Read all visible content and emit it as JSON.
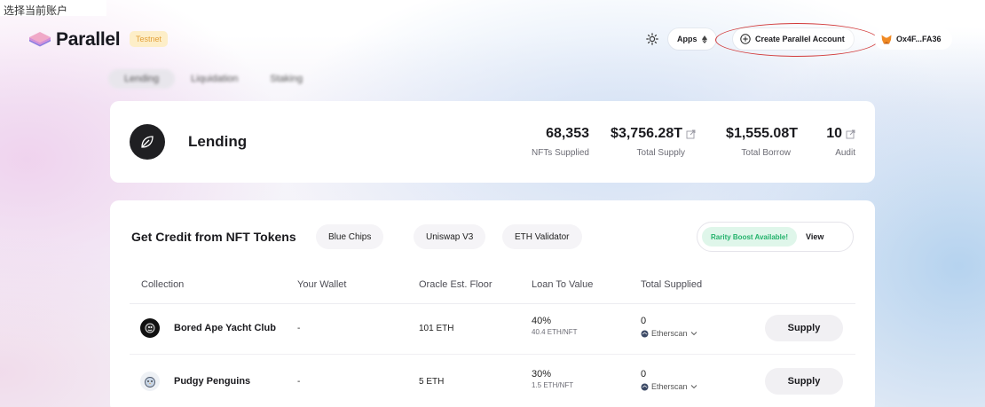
{
  "top_strip": "选择当前账户",
  "header": {
    "logo_text": "Parallel",
    "network_badge": "Testnet",
    "theme_icon": "sun-icon",
    "apps_label": "Apps",
    "create_account_label": "Create Parallel Account",
    "account_label": "Ox4F...FA36",
    "annotation_color": "#d23a3a"
  },
  "subtabs": [
    "Lending",
    "Liquidation",
    "Staking"
  ],
  "lending": {
    "title": "Lending",
    "stats": [
      {
        "value": "68,353",
        "label": "NFTs Supplied",
        "link": false
      },
      {
        "value": "$3,756.28T",
        "label": "Total Supply",
        "link": true
      },
      {
        "value": "$1,555.08T",
        "label": "Total Borrow",
        "link": false
      },
      {
        "value": "10",
        "label": "Audit",
        "link": true
      }
    ]
  },
  "credit": {
    "title": "Get Credit from NFT Tokens",
    "chips": [
      "Blue Chips",
      "Uniswap V3",
      "ETH Validator"
    ],
    "boost_label": "Rarity Boost Available!",
    "view_label": "View",
    "columns": [
      "Collection",
      "Your Wallet",
      "Oracle Est. Floor",
      "Loan To Value",
      "Total Supplied"
    ],
    "rows": [
      {
        "name": "Bored Ape Yacht Club",
        "wallet": "-",
        "floor": "101 ETH",
        "ltv": "40%",
        "ltv_sub": "40.4 ETH/NFT",
        "supplied": "0",
        "supplied_sub": "Etherscan",
        "action": "Supply"
      },
      {
        "name": "Pudgy Penguins",
        "wallet": "-",
        "floor": "5 ETH",
        "ltv": "30%",
        "ltv_sub": "1.5 ETH/NFT",
        "supplied": "0",
        "supplied_sub": "Etherscan",
        "action": "Supply"
      }
    ]
  },
  "colors": {
    "accent_boost": "#23b26b",
    "testnet_badge": "#e3a13a"
  }
}
